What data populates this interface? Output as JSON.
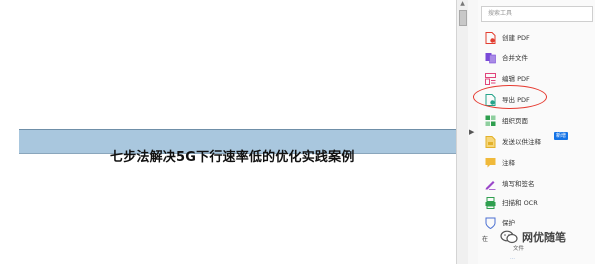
{
  "document": {
    "banner_title": "七步法解决5G下行速率低的优化实践案例"
  },
  "panel": {
    "search_placeholder": "搜索工具",
    "tools": [
      {
        "label": "创建 PDF",
        "icon": "create-pdf-icon",
        "color": "#e33d2f"
      },
      {
        "label": "合并文件",
        "icon": "combine-files-icon",
        "color": "#7a4ad8"
      },
      {
        "label": "编辑 PDF",
        "icon": "edit-pdf-icon",
        "color": "#e0457b"
      },
      {
        "label": "导出 PDF",
        "icon": "export-pdf-icon",
        "color": "#24a38a"
      },
      {
        "label": "组织页面",
        "icon": "organize-pages-icon",
        "color": "#2f9f4f"
      },
      {
        "label": "发送以供注释",
        "icon": "send-for-comments-icon",
        "color": "#e3b12a"
      },
      {
        "label": "注释",
        "icon": "comment-icon",
        "color": "#f0b93a"
      },
      {
        "label": "填写和签名",
        "icon": "fill-sign-icon",
        "color": "#9a47c9"
      },
      {
        "label": "扫描和 OCR",
        "icon": "scan-ocr-icon",
        "color": "#2f9f4f"
      },
      {
        "label": "保护",
        "icon": "protect-icon",
        "color": "#4a6fd1"
      }
    ],
    "new_badge": "新增",
    "partial_bottom_a": "在",
    "partial_bottom_b": "文件",
    "partial_bottom_c": "…"
  },
  "watermark": {
    "text": "网优随笔",
    "icon": "wechat-icon"
  },
  "colors": {
    "banner": "#a9c7de",
    "highlight": "#e63a30"
  }
}
